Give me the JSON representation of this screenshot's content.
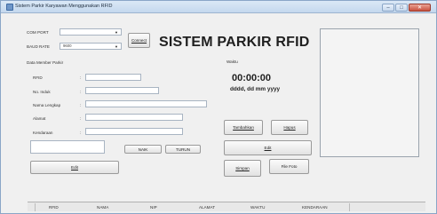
{
  "window": {
    "title": "Sistem Parkir Karyawan Menggunakan RFID"
  },
  "connection": {
    "com_port_label": "COM PORT",
    "com_port_value": "",
    "baud_rate_label": "BAUD RATE",
    "baud_rate_value": "9600",
    "connect_button": "Connect"
  },
  "main_title": "SISTEM PARKIR RFID",
  "member_form": {
    "section_label": "Data Member Parkir",
    "fields": [
      {
        "label": "RFID",
        "colon": ":"
      },
      {
        "label": "No. Induk",
        "colon": ":"
      },
      {
        "label": "Nama Lengkap",
        "colon": ":"
      },
      {
        "label": "Alamat",
        "colon": ":"
      },
      {
        "label": "Kendaraan",
        "colon": ":"
      }
    ],
    "naik_button": "NAIK",
    "turun_button": "TURUN",
    "edit_button": "Edit"
  },
  "time_panel": {
    "label": "Waktu",
    "clock": "00:00:00",
    "date": "dddd, dd mm yyyy"
  },
  "actions": {
    "tambahkan": "Tambahkan",
    "hapus": "Hapus",
    "edit": "Edit",
    "simpan": "Simpan",
    "file_foto": "File Foto"
  },
  "table": {
    "columns": [
      "RFID",
      "NAMA",
      "NIP",
      "ALAMAT",
      "WAKTU",
      "KENDARAAN"
    ]
  },
  "colors": {
    "title_bar": "#c4d8ee",
    "close_button": "#c9513f",
    "window_bg": "#f0f0f0"
  }
}
